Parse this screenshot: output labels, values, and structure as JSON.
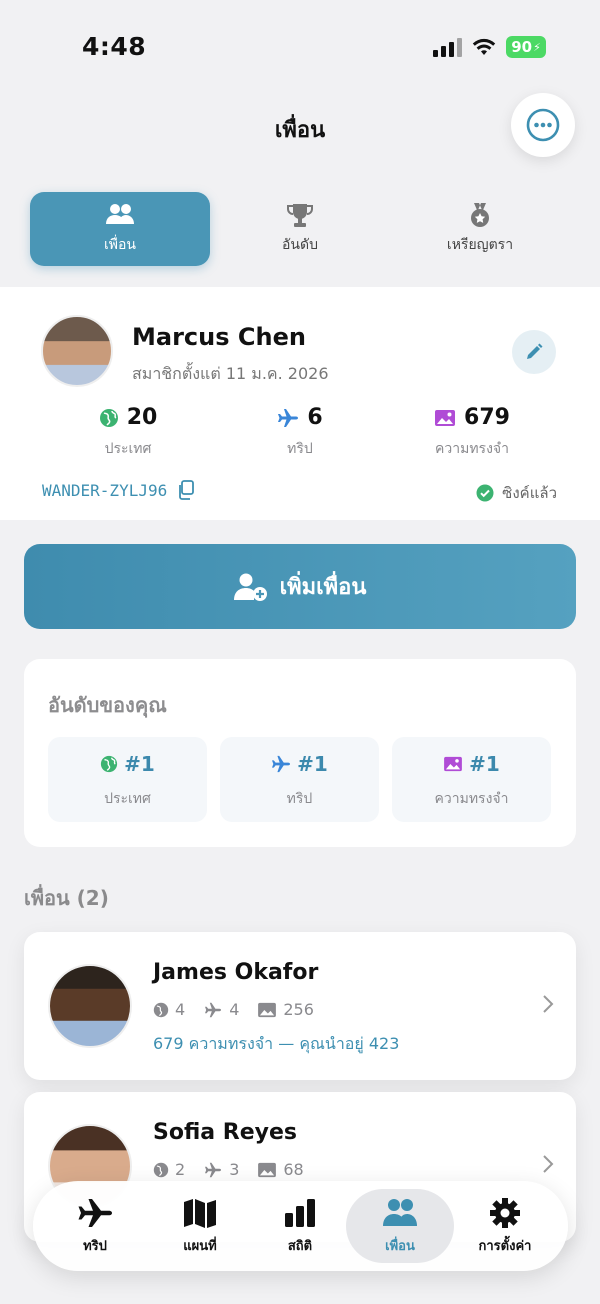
{
  "status_bar": {
    "time": "4:48",
    "battery": "90"
  },
  "header": {
    "title": "เพื่อน"
  },
  "segments": [
    {
      "label": "เพื่อน",
      "icon": "people-icon",
      "active": true
    },
    {
      "label": "อันดับ",
      "icon": "trophy-icon",
      "active": false
    },
    {
      "label": "เหรียญตรา",
      "icon": "medal-icon",
      "active": false
    }
  ],
  "profile": {
    "name": "Marcus Chen",
    "member_since": "สมาชิกตั้งแต่ 11 ม.ค. 2026",
    "stats": [
      {
        "value": "20",
        "label": "ประเทศ",
        "icon": "globe-icon"
      },
      {
        "value": "6",
        "label": "ทริป",
        "icon": "plane-icon"
      },
      {
        "value": "679",
        "label": "ความทรงจำ",
        "icon": "photo-icon"
      }
    ],
    "code": "WANDER-ZYLJ96",
    "sync_status": "ซิงค์แล้ว"
  },
  "add_friend": {
    "label": "เพิ่มเพื่อน"
  },
  "ranking": {
    "title": "อันดับของคุณ",
    "items": [
      {
        "value": "#1",
        "label": "ประเทศ",
        "icon": "globe-icon"
      },
      {
        "value": "#1",
        "label": "ทริป",
        "icon": "plane-icon"
      },
      {
        "value": "#1",
        "label": "ความทรงจำ",
        "icon": "photo-icon"
      }
    ]
  },
  "friends_section": {
    "label": "เพื่อน (2)"
  },
  "friends": [
    {
      "name": "James Okafor",
      "countries": "4",
      "trips": "4",
      "memories": "256",
      "note": "679 ความทรงจำ — คุณนำอยู่ 423"
    },
    {
      "name": "Sofia Reyes",
      "countries": "2",
      "trips": "3",
      "memories": "68",
      "note": ""
    }
  ],
  "tabbar": [
    {
      "label": "ทริป",
      "icon": "airplane-icon",
      "active": false
    },
    {
      "label": "แผนที่",
      "icon": "map-icon",
      "active": false
    },
    {
      "label": "สถิติ",
      "icon": "bar-chart-icon",
      "active": false
    },
    {
      "label": "เพื่อน",
      "icon": "people-icon",
      "active": true
    },
    {
      "label": "การตั้งค่า",
      "icon": "gear-icon",
      "active": false
    }
  ],
  "colors": {
    "accent": "#4a96b6",
    "link": "#3d8fb1",
    "globe": "#3cb371",
    "plane": "#3a86d8",
    "photo": "#b04cd6"
  }
}
